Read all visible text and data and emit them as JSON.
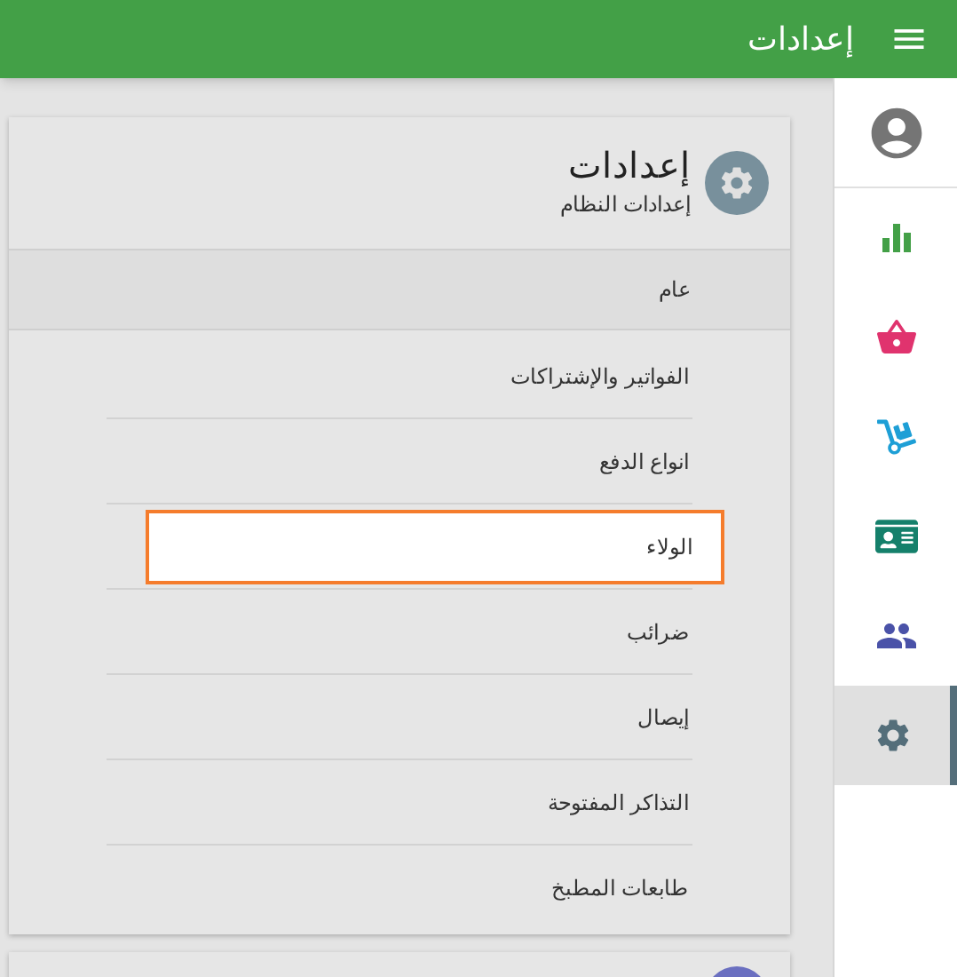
{
  "header": {
    "title": "إعدادات"
  },
  "sidebar": {
    "items": [
      {
        "kind": "account",
        "selected": false,
        "color": "#757575"
      },
      {
        "kind": "chart",
        "selected": false,
        "color": "#43a047"
      },
      {
        "kind": "basket",
        "selected": false,
        "color": "#e0336e"
      },
      {
        "kind": "dolly",
        "selected": false,
        "color": "#1e9fd6"
      },
      {
        "kind": "card",
        "selected": false,
        "color": "#15806b"
      },
      {
        "kind": "people",
        "selected": false,
        "color": "#4a52a8"
      },
      {
        "kind": "settings",
        "selected": true,
        "color": "#546e7a"
      }
    ]
  },
  "settings_card": {
    "title": "إعدادات",
    "subtitle": "إعدادات النظام",
    "section": "عام",
    "items": [
      {
        "label": "الفواتير والإشتراكات",
        "selected": false
      },
      {
        "label": "انواع الدفع",
        "selected": false
      },
      {
        "label": "الولاء",
        "selected": true
      },
      {
        "label": "ضرائب",
        "selected": false
      },
      {
        "label": "إيصال",
        "selected": false
      },
      {
        "label": "التذاكر المفتوحة",
        "selected": false
      },
      {
        "label": "طابعات المطبخ",
        "selected": false
      }
    ]
  }
}
